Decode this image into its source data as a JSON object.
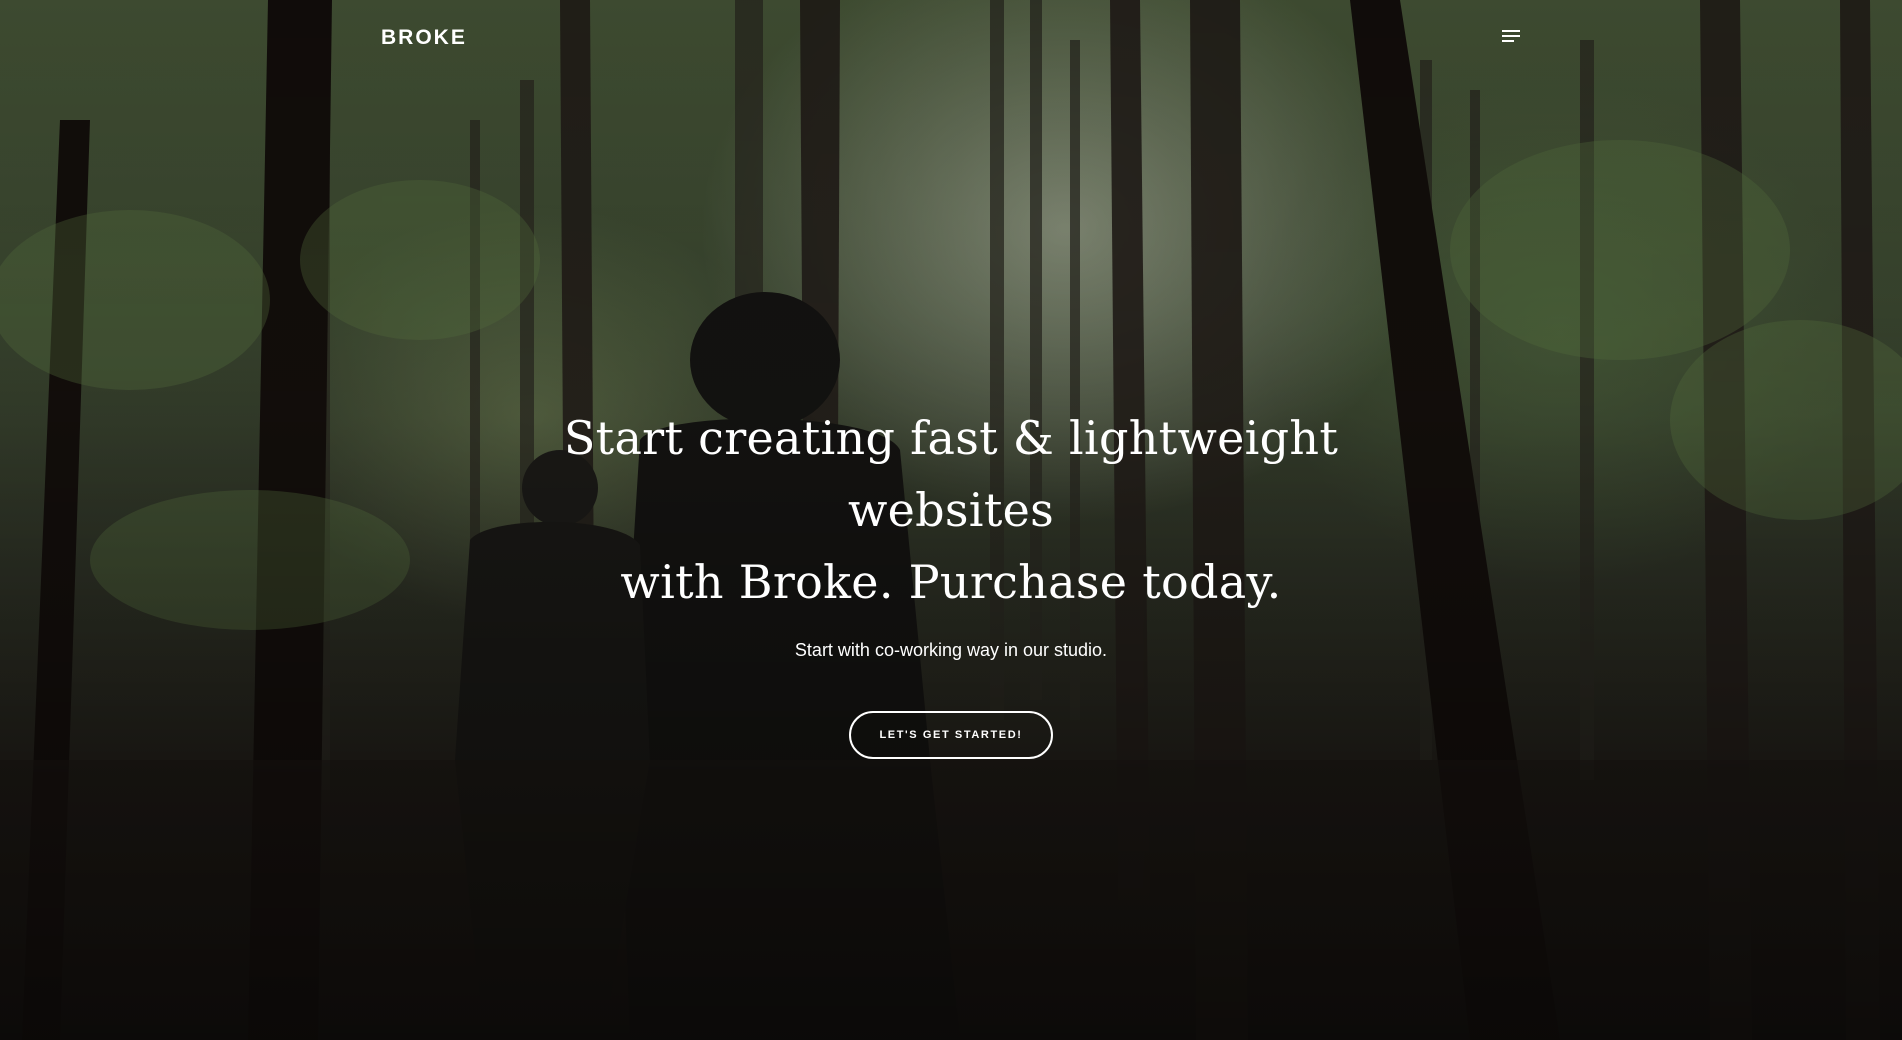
{
  "header": {
    "logo_text": "BROKE",
    "menu_icon": "hamburger-menu-icon"
  },
  "hero": {
    "headline_line1": "Start creating fast & lightweight websites",
    "headline_line2": "with Broke. Purchase today.",
    "subtitle": "Start with co-working way in our studio.",
    "cta_label": "LET'S GET STARTED!",
    "background": "forest-video-background"
  },
  "colors": {
    "text": "#ffffff",
    "forest_green": "#3d4a32",
    "shadow": "#1a1714"
  }
}
